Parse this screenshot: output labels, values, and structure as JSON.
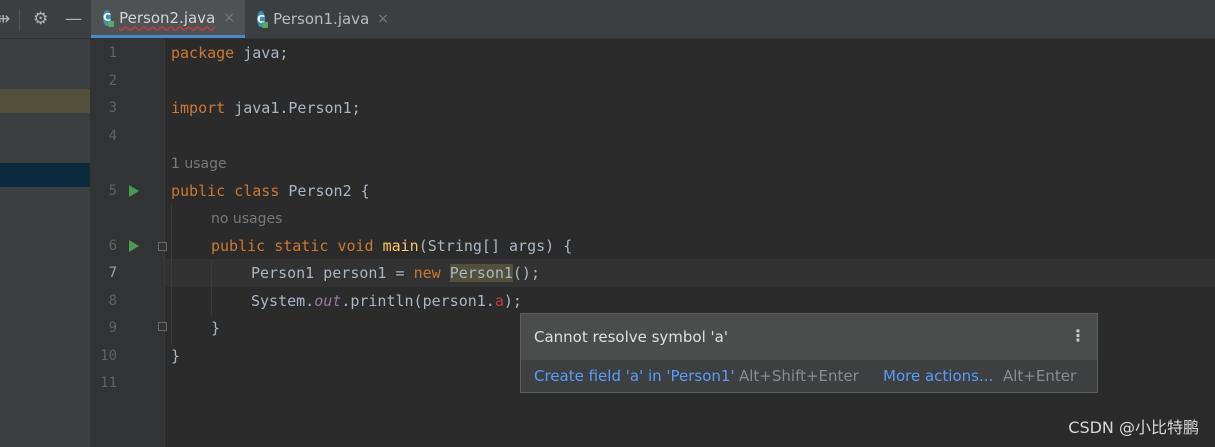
{
  "toolbar": {
    "icons": [
      "split-icon",
      "gear-icon",
      "minimize-icon"
    ]
  },
  "tabs": [
    {
      "label": "Person2.java",
      "active": true,
      "close": "×"
    },
    {
      "label": "Person1.java",
      "active": false,
      "close": "×"
    }
  ],
  "editor": {
    "line_numbers": [
      "1",
      "2",
      "3",
      "4",
      "5",
      "6",
      "7",
      "8",
      "9",
      "10",
      "11"
    ],
    "hints": {
      "usage_1": "1 usage",
      "no_usages": "no usages"
    },
    "code": {
      "l1_kw": "package",
      "l1_rest": " java;",
      "l3_kw": "import",
      "l3_rest": " java1.Person1;",
      "l5_kw1": "public",
      "l5_kw2": "class",
      "l5_rest": " Person2 {",
      "l6_kw1": "public",
      "l6_kw2": "static",
      "l6_kw3": "void",
      "l6_fn": "main",
      "l6_rest": "(String[] args) {",
      "l7_a": "Person1 person1 = ",
      "l7_kw": "new",
      "l7_hl": "Person1",
      "l7_end": "();",
      "l8_a": "System.",
      "l8_out": "out",
      "l8_b": ".println(person1.",
      "l8_err": "a",
      "l8_end": ");",
      "l9": "}",
      "l10": "}"
    }
  },
  "popup": {
    "message": "Cannot resolve symbol 'a'",
    "more_icon": "⋮",
    "primary_action": "Create field 'a' in 'Person1'",
    "primary_shortcut": "Alt+Shift+Enter",
    "secondary_action": "More actions...",
    "secondary_shortcut": "Alt+Enter"
  },
  "watermark": "CSDN @小比特鹏",
  "colors": {
    "keyword": "#cc7832",
    "method": "#ffc66d",
    "static_field": "#9876aa",
    "link": "#589df6",
    "error": "#bc3f3c"
  }
}
